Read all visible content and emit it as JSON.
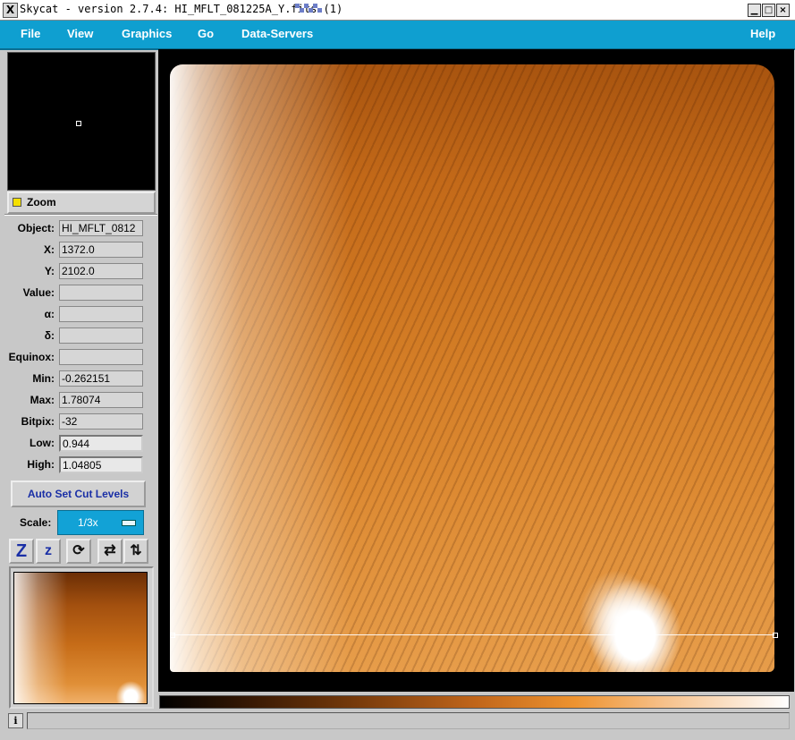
{
  "window": {
    "title": "Skycat - version 2.7.4: HI_MFLT_081225A_Y.fits (1)",
    "app_icon": "window-menu-icon",
    "buttons": [
      "minimize-icon",
      "maximize-icon",
      "close-icon"
    ]
  },
  "menubar": {
    "items": [
      {
        "label": "File"
      },
      {
        "label": "View"
      },
      {
        "label": "Graphics"
      },
      {
        "label": "Go"
      },
      {
        "label": "Data-Servers"
      },
      {
        "label": "Help"
      }
    ]
  },
  "zoom": {
    "label": "Zoom"
  },
  "info": {
    "object_label": "Object:",
    "object": "HI_MFLT_0812",
    "x_label": "X:",
    "x": "1372.0",
    "y_label": "Y:",
    "y": "2102.0",
    "value_label": "Value:",
    "value": "",
    "alpha_label": "α:",
    "alpha": "",
    "delta_label": "δ:",
    "delta": "",
    "equinox_label": "Equinox:",
    "equinox": "",
    "min_label": "Min:",
    "min": "-0.262151",
    "max_label": "Max:",
    "max": "1.78074",
    "bitpix_label": "Bitpix:",
    "bitpix": "-32",
    "low_label": "Low:",
    "low": "0.944",
    "high_label": "High:",
    "high": "1.04805"
  },
  "auto_cut_label": "Auto Set Cut Levels",
  "scale": {
    "label": "Scale:",
    "value": "1/3x"
  },
  "toolbar": {
    "zoom_in": "Z",
    "zoom_out": "z",
    "icons": [
      "zoom-in-icon",
      "zoom-out-icon",
      "rotate-icon",
      "flip-x-icon",
      "flip-y-icon"
    ]
  },
  "status": {
    "info_icon": "i",
    "message": ""
  },
  "colors": {
    "menubar": "#0f9fd0",
    "accent_text": "#1a2fa6",
    "zoom_indicator": "#f5e000"
  }
}
